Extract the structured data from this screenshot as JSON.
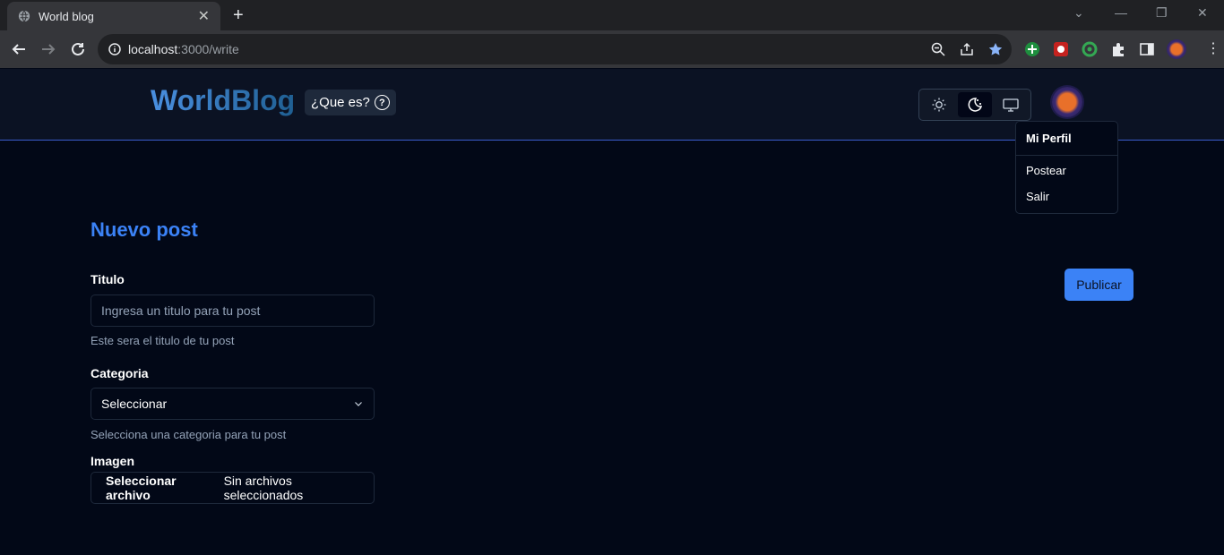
{
  "browser": {
    "tab_title": "World blog",
    "url_host": "localhost",
    "url_path": ":3000/write"
  },
  "header": {
    "brand": "WorldBlog",
    "whatis_label": "¿Que es?",
    "theme_options": [
      "sun-icon",
      "moon-icon",
      "monitor-icon"
    ],
    "active_theme": "moon-icon"
  },
  "user_menu": {
    "label": "Mi Perfil",
    "items": [
      "Postear",
      "Salir"
    ]
  },
  "form": {
    "heading": "Nuevo post",
    "title": {
      "label": "Titulo",
      "placeholder": "Ingresa un titulo para tu post",
      "help": "Este sera el titulo de tu post"
    },
    "category": {
      "label": "Categoria",
      "value": "Seleccionar",
      "help": "Selecciona una categoria para tu post"
    },
    "image": {
      "label": "Imagen",
      "button": "Seleccionar archivo",
      "status": "Sin archivos seleccionados"
    },
    "publish": "Publicar"
  },
  "colors": {
    "accent": "#3b82f6",
    "background": "#020817",
    "header_bg": "#0b1223"
  }
}
